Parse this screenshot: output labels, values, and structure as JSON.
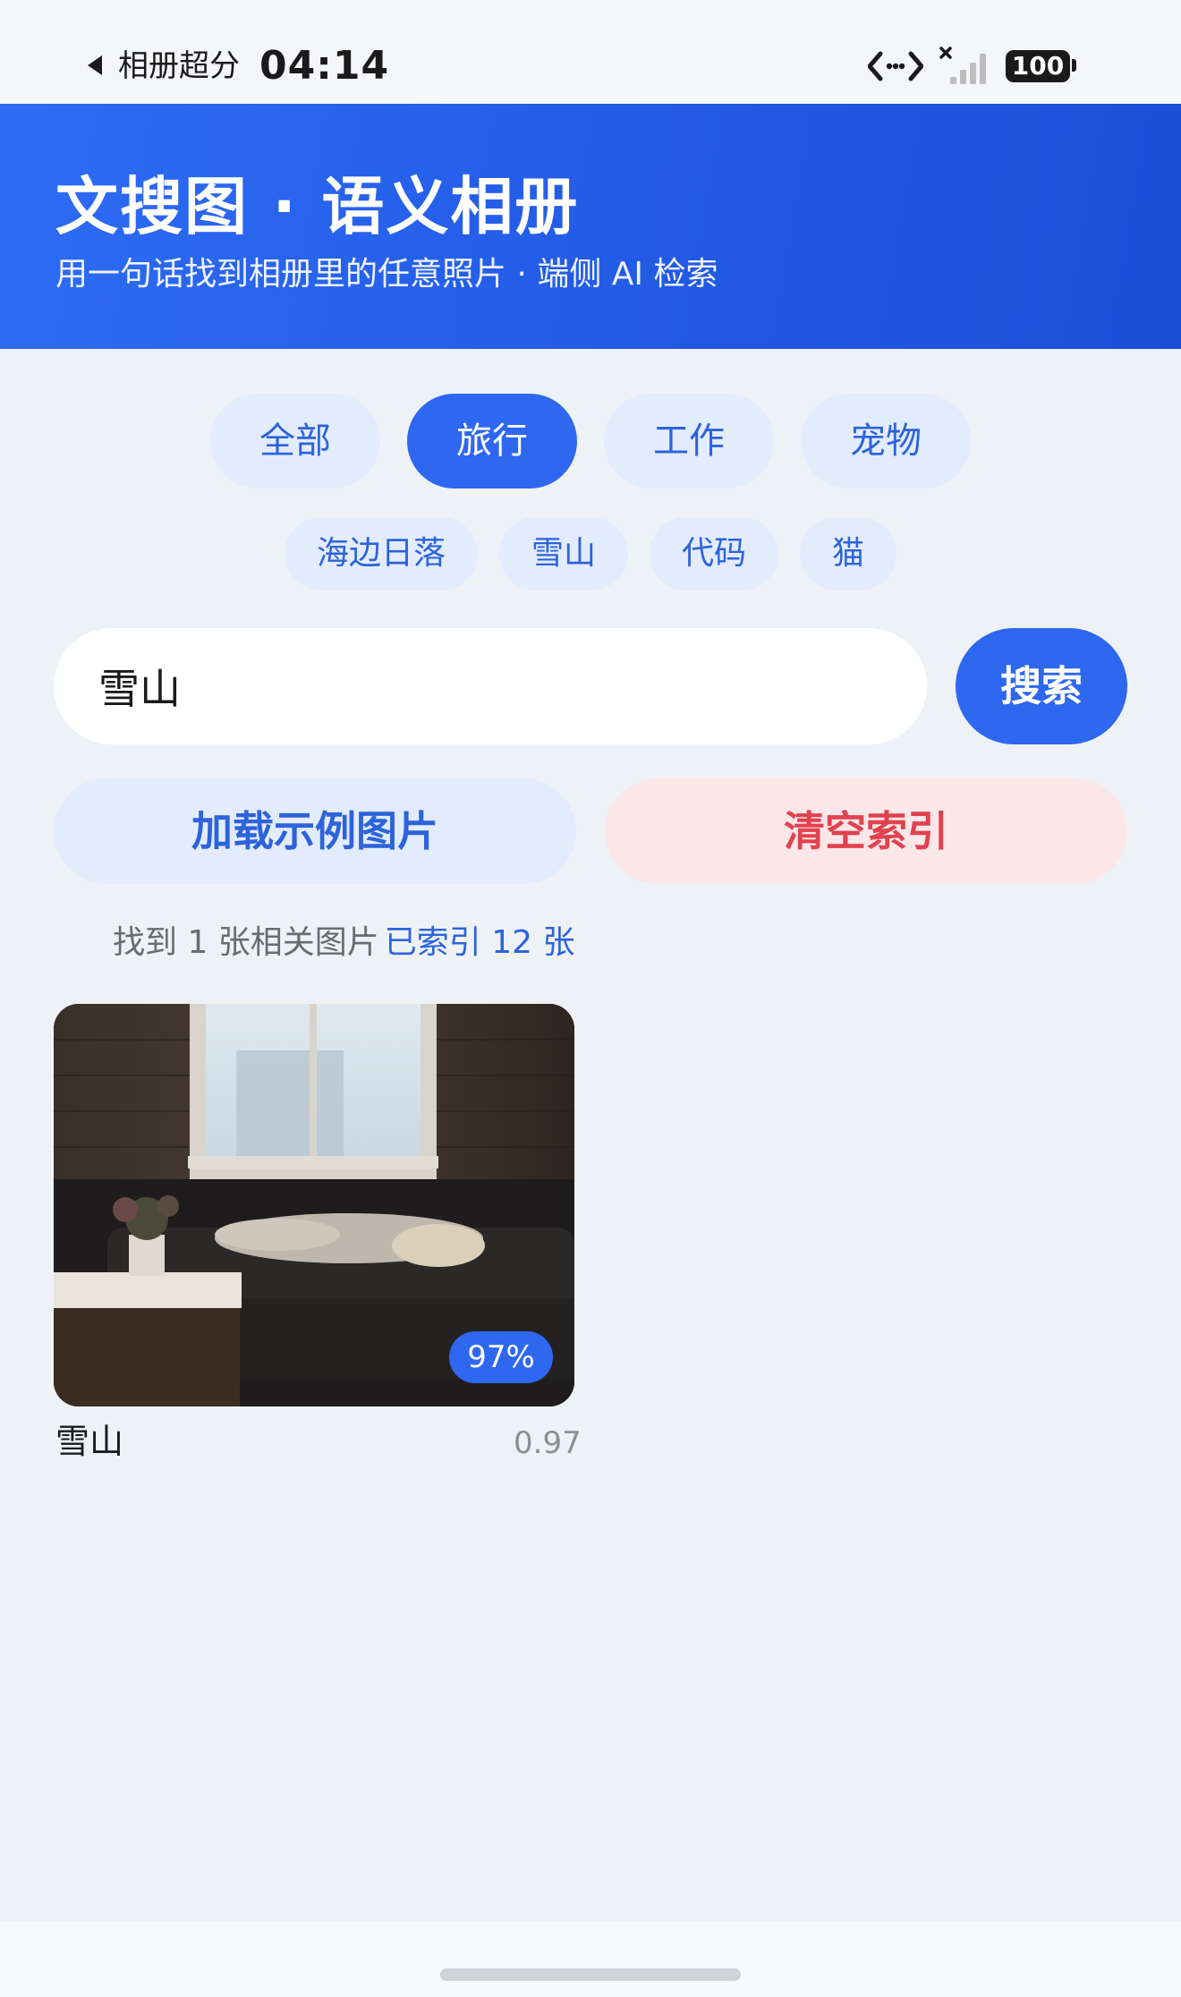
{
  "status_bar": {
    "app_name": "相册超分",
    "time": "04:14",
    "battery": "100"
  },
  "header": {
    "title": "文搜图 · 语义相册",
    "subtitle": "用一句话找到相册里的任意照片 · 端侧 AI 检索"
  },
  "categories": [
    {
      "label": "全部",
      "active": false
    },
    {
      "label": "旅行",
      "active": true
    },
    {
      "label": "工作",
      "active": false
    },
    {
      "label": "宠物",
      "active": false
    }
  ],
  "suggestions": [
    "海边日落",
    "雪山",
    "代码",
    "猫"
  ],
  "search": {
    "value": "雪山",
    "button_label": "搜索"
  },
  "actions": {
    "load_label": "加载示例图片",
    "clear_label": "清空索引"
  },
  "results_info": {
    "found": "找到 1 张相关图片",
    "indexed": "已索引 12 张"
  },
  "results": [
    {
      "label": "雪山",
      "badge": "97%",
      "score": "0.97"
    }
  ],
  "colors": {
    "primary": "#2e67f0",
    "chip_bg": "#e3ecfc",
    "danger": "#e0424f",
    "danger_bg": "#fbe6e8",
    "page_bg": "#eef2f7"
  }
}
